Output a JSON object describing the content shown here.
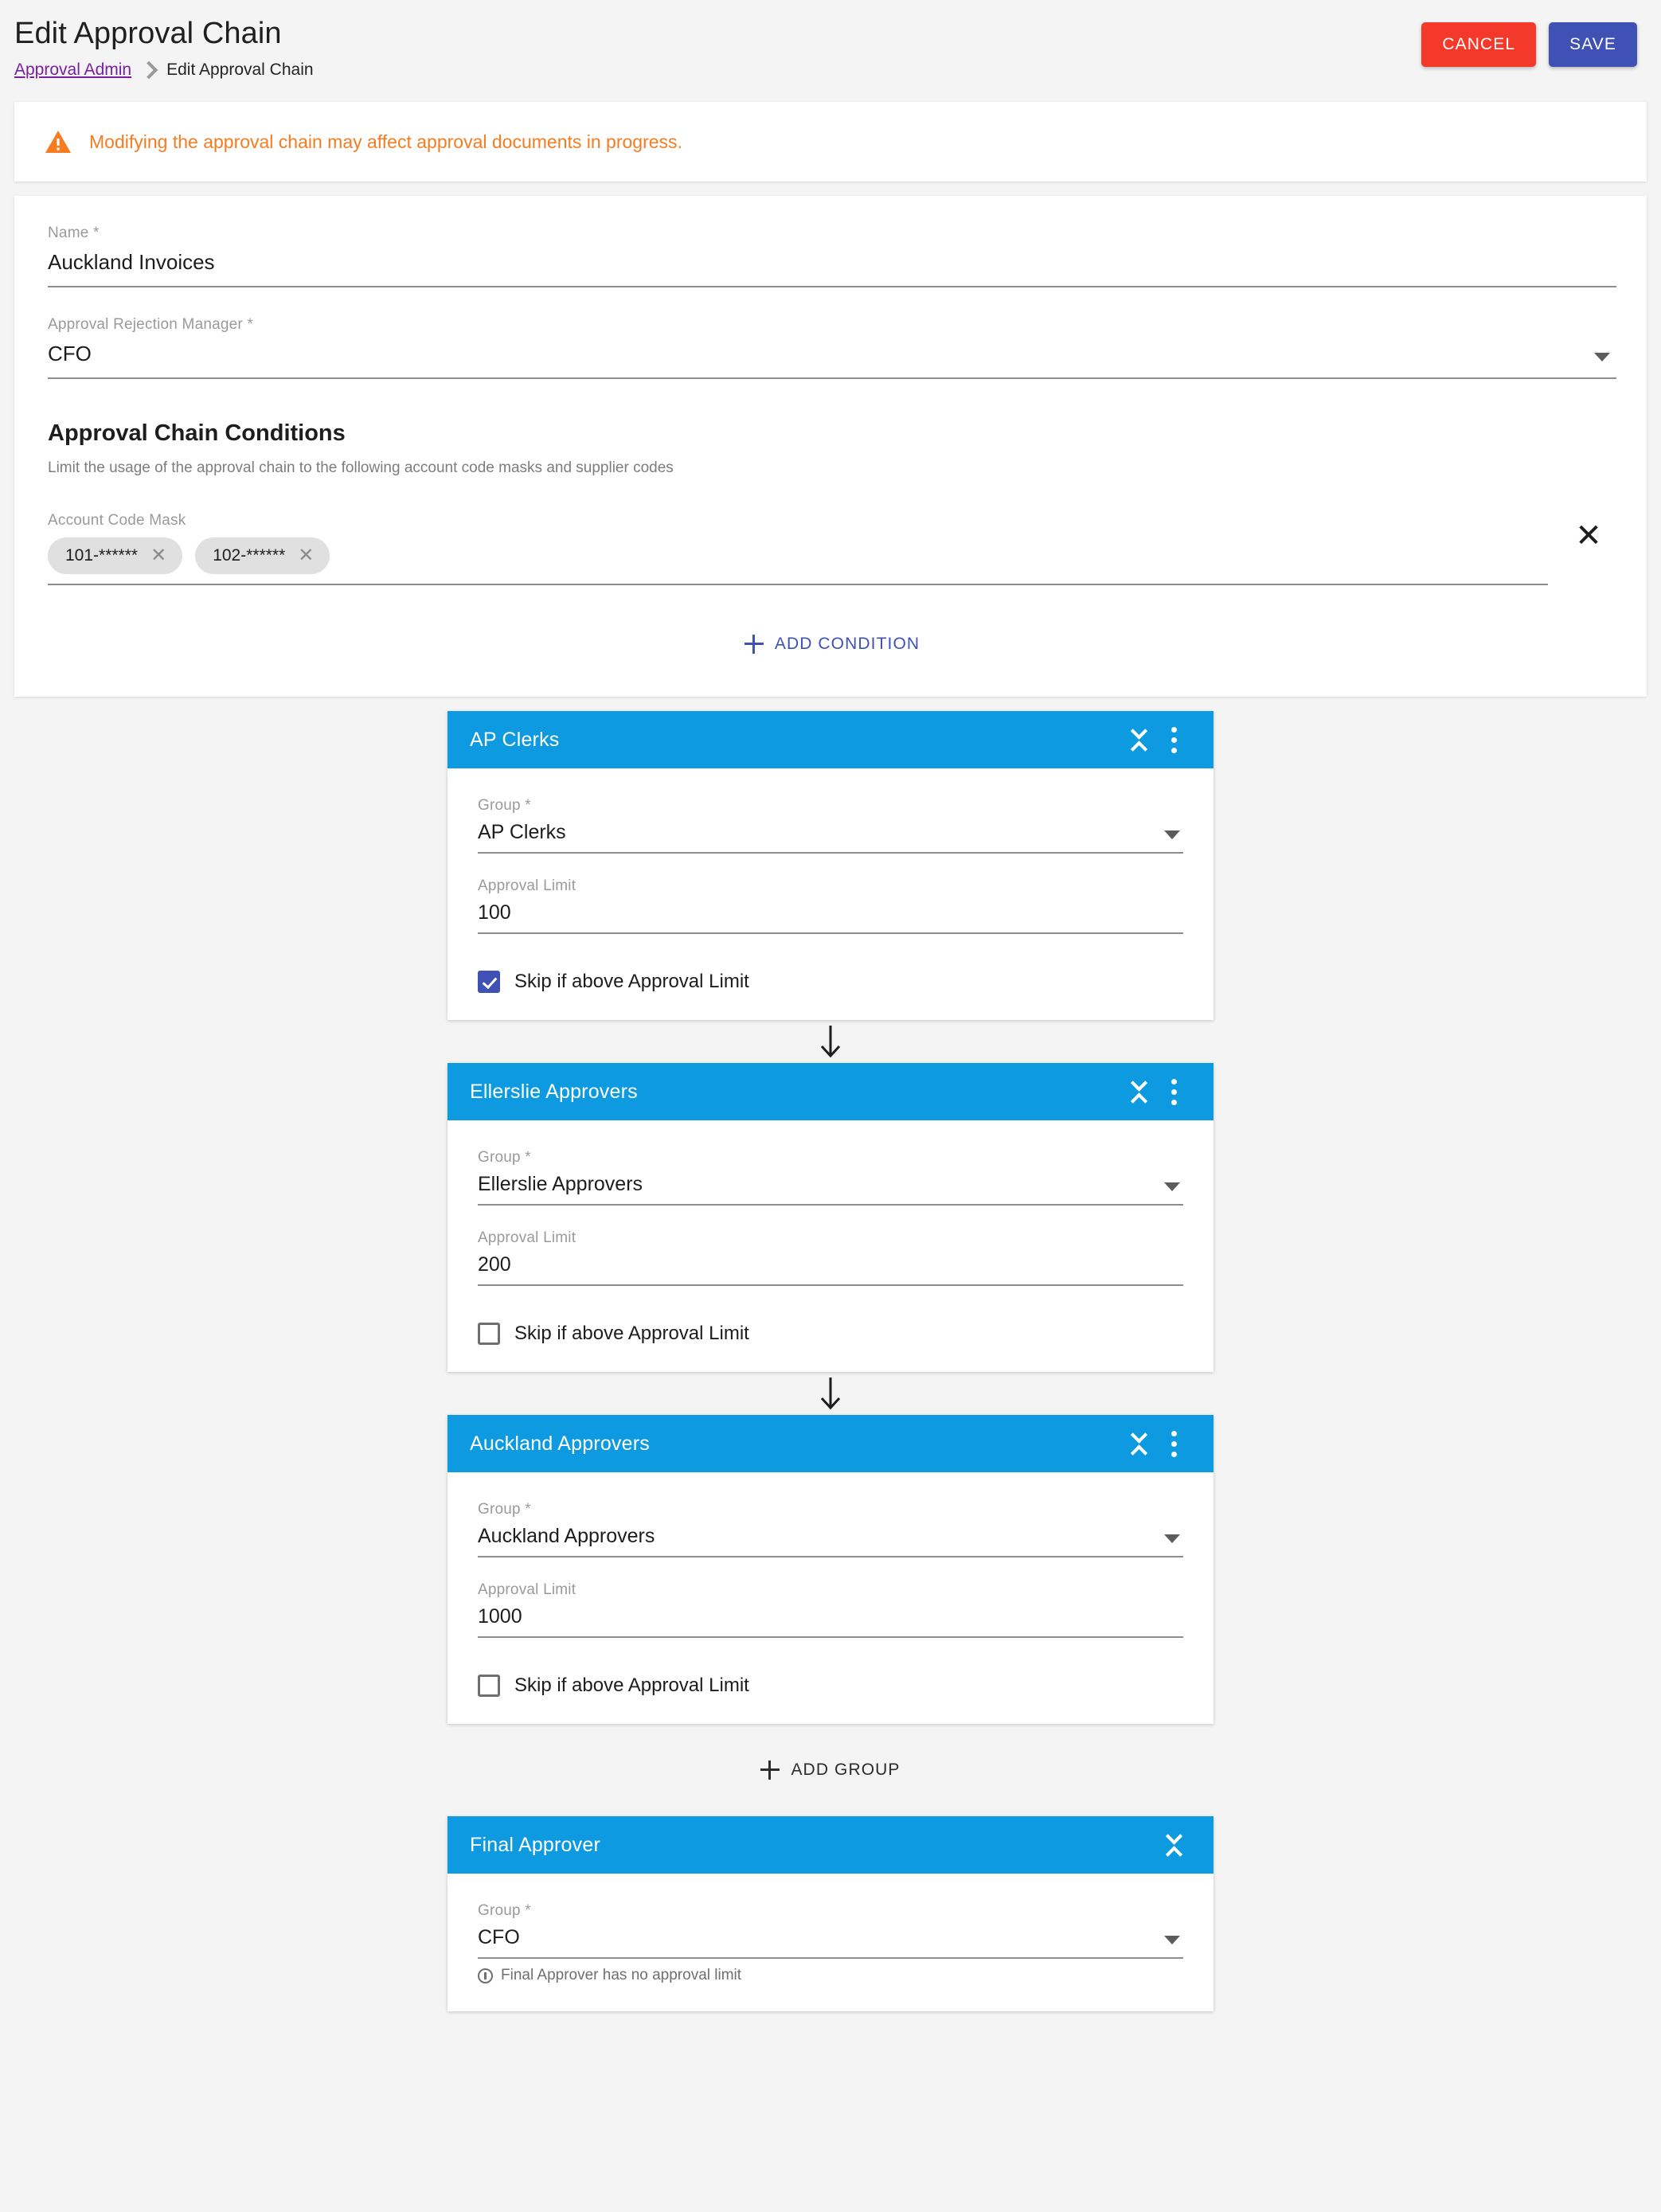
{
  "header": {
    "title": "Edit Approval Chain",
    "breadcrumb": {
      "link": "Approval Admin",
      "separator_icon": "chevron-right-icon",
      "current": "Edit Approval Chain"
    },
    "cancel_label": "CANCEL",
    "save_label": "SAVE",
    "cancel_color": "#f4382a",
    "save_color": "#3f51b5"
  },
  "warning": {
    "icon": "warning-triangle-icon",
    "text": "Modifying the approval chain may affect approval documents in progress.",
    "color": "#f57c20"
  },
  "form": {
    "name": {
      "label": "Name *",
      "value": "Auckland Invoices"
    },
    "rejection_manager": {
      "label": "Approval Rejection Manager *",
      "value": "CFO",
      "dropdown_icon": "caret-down-icon"
    },
    "conditions": {
      "heading": "Approval Chain Conditions",
      "description": "Limit the usage of the approval chain to the following account code masks and supplier codes",
      "account_code_mask": {
        "label": "Account Code Mask",
        "chips": [
          {
            "text": "101-******",
            "remove_icon": "close-icon"
          },
          {
            "text": "102-******",
            "remove_icon": "close-icon"
          }
        ],
        "delete_icon": "close-icon"
      },
      "add_condition_label": "ADD CONDITION",
      "add_condition_icon": "plus-icon",
      "add_condition_color": "#3f51b5"
    }
  },
  "chain": {
    "header_color": "#0d9ae0",
    "connector_icon": "arrow-down-icon",
    "collapse_icon": "unfold-less-icon",
    "menu_icon": "more-vertical-icon",
    "group_label": "Group *",
    "approval_limit_label": "Approval Limit",
    "skip_label": "Skip if above Approval Limit",
    "add_group_label": "ADD GROUP",
    "add_group_icon": "plus-icon",
    "cards": [
      {
        "title": "AP Clerks",
        "group_value": "AP Clerks",
        "approval_limit": "100",
        "skip_checked": true,
        "has_menu": true
      },
      {
        "title": "Ellerslie Approvers",
        "group_value": "Ellerslie Approvers",
        "approval_limit": "200",
        "skip_checked": false,
        "has_menu": true
      },
      {
        "title": "Auckland Approvers",
        "group_value": "Auckland Approvers",
        "approval_limit": "1000",
        "skip_checked": false,
        "has_menu": true
      }
    ],
    "final_approver": {
      "title": "Final Approver",
      "group_label": "Group *",
      "group_value": "CFO",
      "hint": "Final Approver has no approval limit",
      "hint_icon": "info-icon",
      "has_menu": false
    }
  }
}
